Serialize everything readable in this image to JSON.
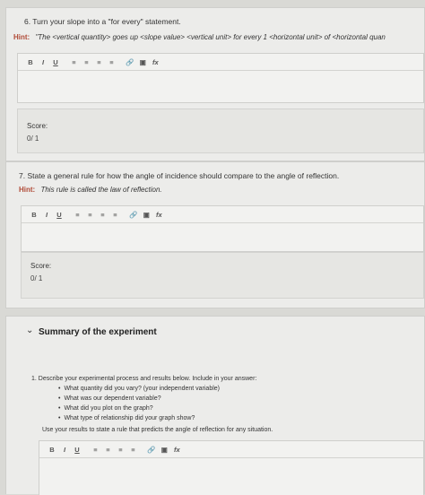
{
  "q6": {
    "question": "6. Turn your slope into a \"for every\" statement.",
    "hint_label": "Hint:",
    "hint_text": "\"The <vertical quantity> goes up <slope value> <vertical unit> for every 1 <horizontal unit> of <horizontal quan",
    "score_label": "Score:",
    "score_value": "0/ 1"
  },
  "q7": {
    "question": "7. State a general rule for how the angle of incidence should compare to the angle of reflection.",
    "hint_label": "Hint:",
    "hint_text": "This rule is called the law of reflection.",
    "score_label": "Score:",
    "score_value": "0/ 1"
  },
  "toolbar": {
    "bold": "B",
    "italic": "I",
    "underline": "U",
    "list_ordered": "≡",
    "list_unordered": "≡",
    "indent": "≡",
    "outdent": "≡",
    "link_icon": "🔗",
    "image_icon": "▣",
    "formula": "fx"
  },
  "summary": {
    "title": "Summary of the experiment",
    "q1_intro": "1. Describe your experimental process and results below. Include in your answer:",
    "bullets": [
      "What quantity did you vary? (your independent variable)",
      "What was our dependent variable?",
      "What did you plot on the graph?",
      "What type of relationship did your graph show?"
    ],
    "closing": "Use your results to state a rule that predicts the angle of reflection for any situation."
  }
}
